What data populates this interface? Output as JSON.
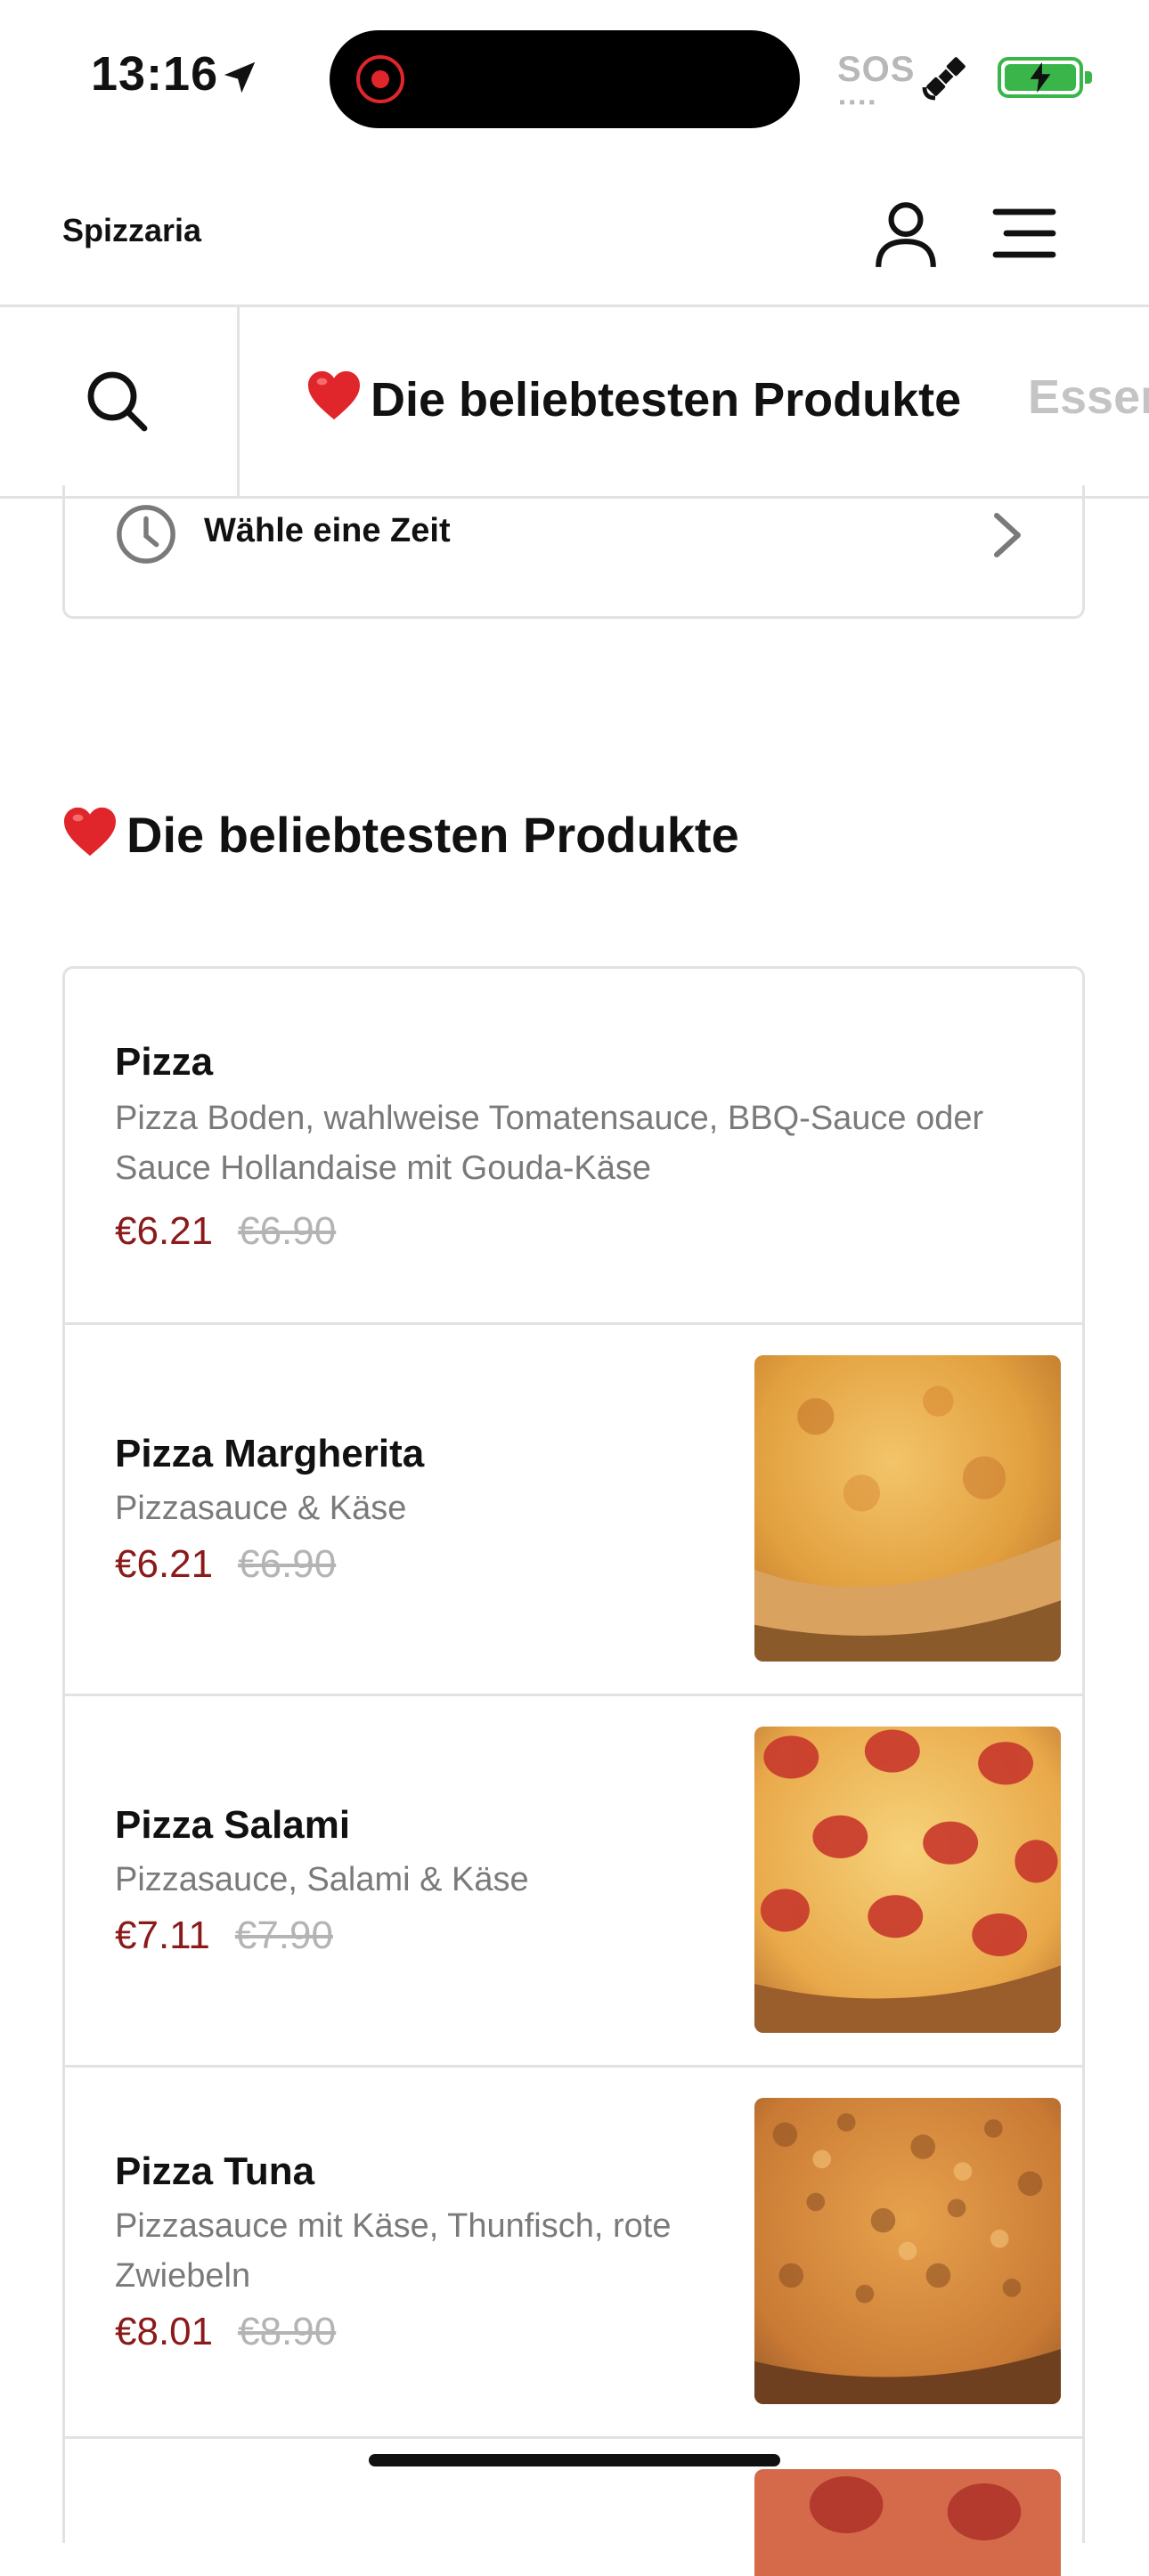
{
  "status_bar": {
    "time": "13:16",
    "sos": "SOS",
    "battery_color": "#3ab54a",
    "record_color": "#e0262b"
  },
  "header": {
    "brand": "Spizzaria",
    "icons": [
      "user-icon",
      "menu-icon"
    ]
  },
  "category_nav": {
    "search_icon": "search-icon",
    "active_category": "Die beliebtesten Produkte",
    "next_category": "Essen"
  },
  "time_selector": {
    "label": "Wähle eine Zeit"
  },
  "section": {
    "title": "Die beliebtesten Produkte"
  },
  "colors": {
    "price": "#8b1a1a",
    "old_price": "#b4b4b4",
    "description": "#7a7a7a"
  },
  "products": [
    {
      "name": "Pizza",
      "description": "Pizza Boden, wahlweise Tomatensauce, BBQ-Sauce oder Sauce Hollandaise mit Gouda-Käse",
      "price": "€6.21",
      "old_price": "€6.90"
    },
    {
      "name": "Pizza Margherita",
      "description": "Pizzasauce & Käse",
      "price": "€6.21",
      "old_price": "€6.90"
    },
    {
      "name": "Pizza Salami",
      "description": "Pizzasauce, Salami & Käse",
      "price": "€7.11",
      "old_price": "€7.90"
    },
    {
      "name": "Pizza Tuna",
      "description": "Pizzasauce mit Käse, Thunfisch, rote Zwiebeln",
      "price": "€8.01",
      "old_price": "€8.90"
    }
  ]
}
